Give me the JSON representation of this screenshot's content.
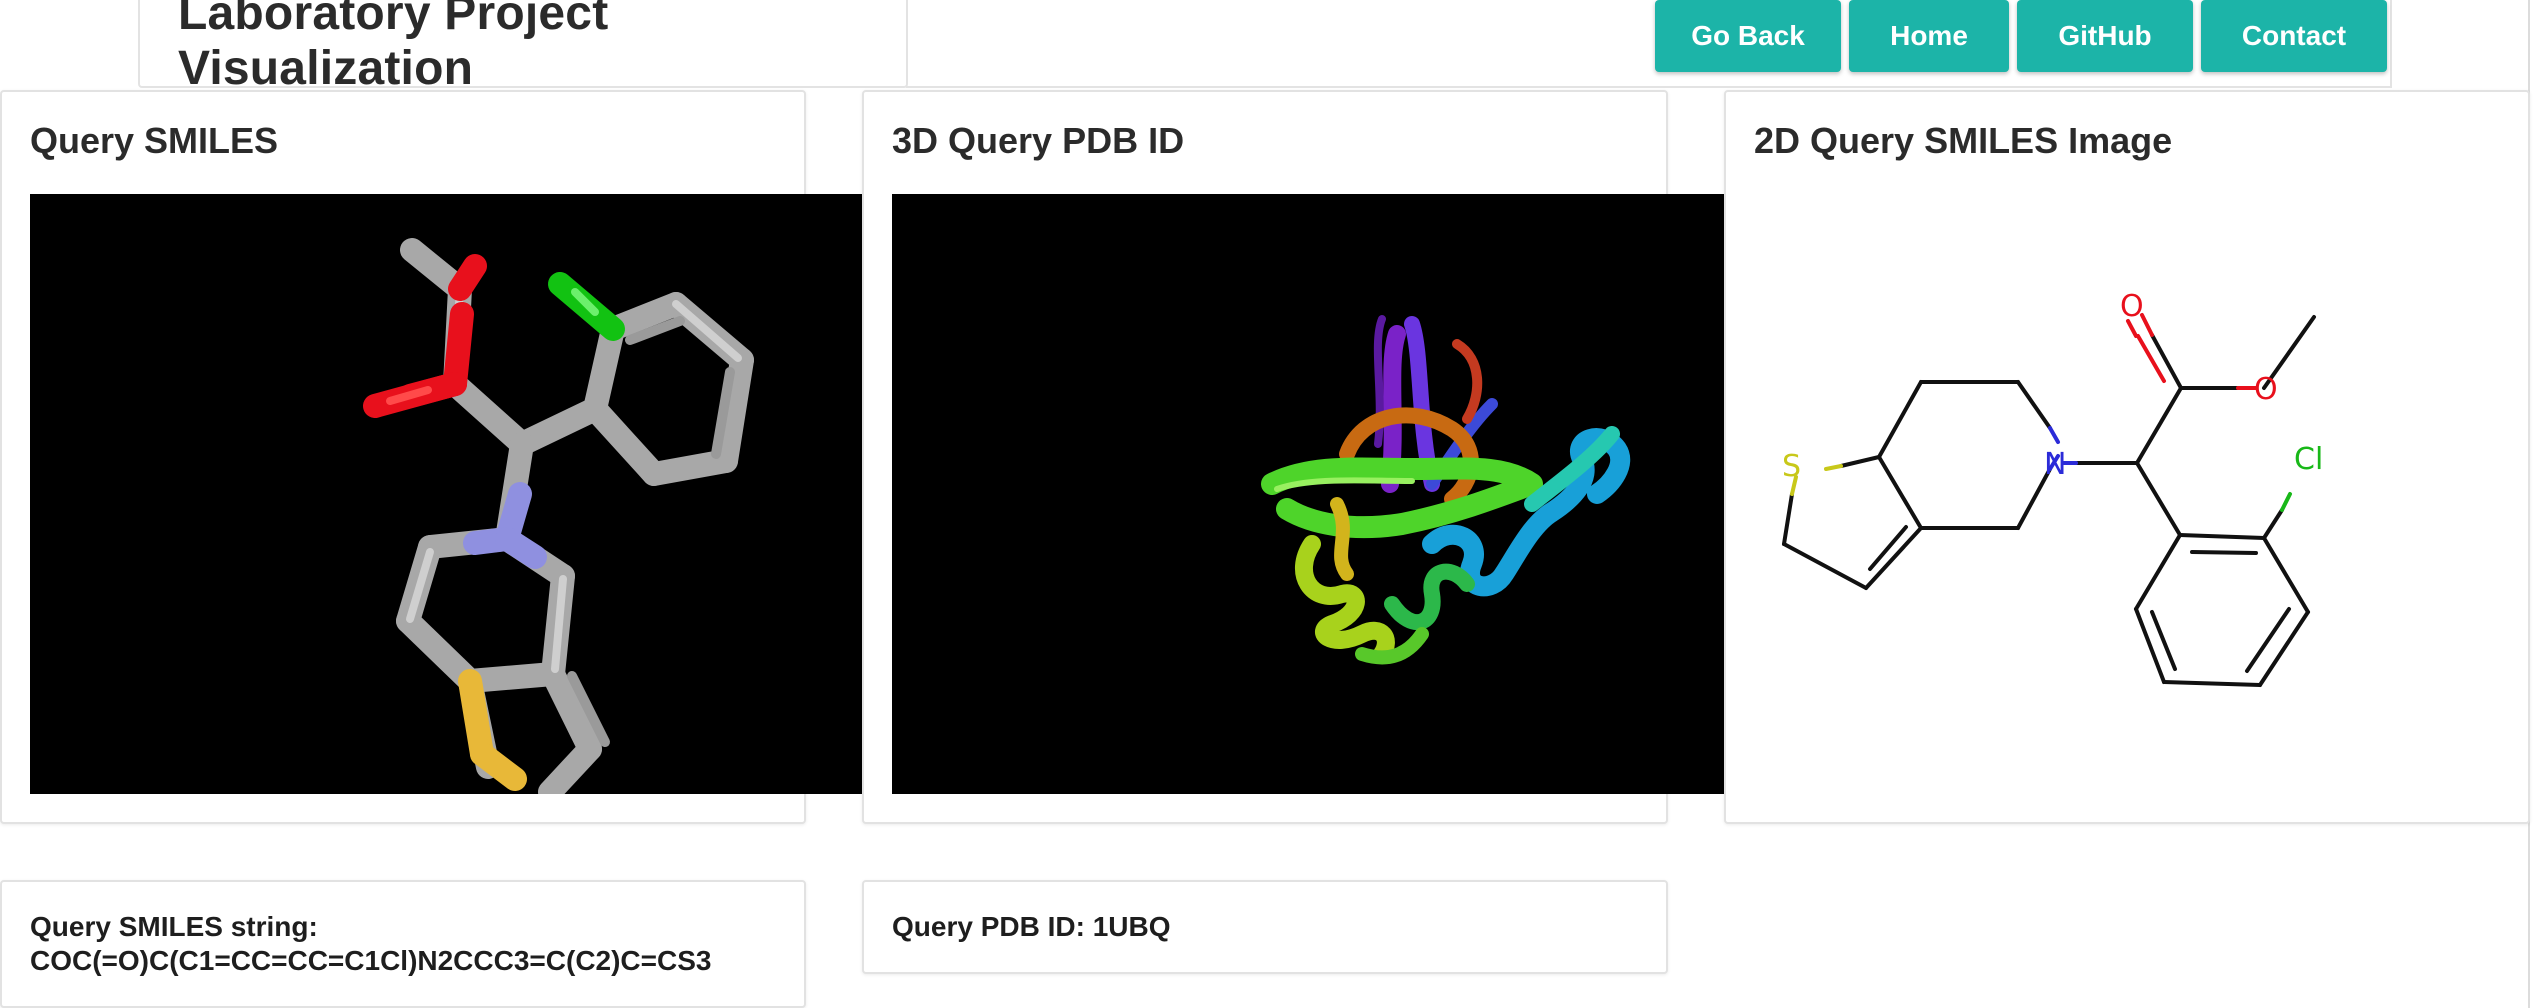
{
  "header": {
    "title": "Laboratory Project Visualization",
    "nav": [
      {
        "label": "Go Back"
      },
      {
        "label": "Home"
      },
      {
        "label": "GitHub"
      },
      {
        "label": "Contact"
      }
    ]
  },
  "panels": {
    "query_smiles": {
      "title": "Query SMILES",
      "atom_labels": [
        "O",
        "O",
        "Cl",
        "N",
        "S"
      ]
    },
    "pdb_3d": {
      "title": "3D Query PDB ID"
    },
    "smiles_2d": {
      "title": "2D Query SMILES Image",
      "atom_labels": {
        "o1": "O",
        "o2": "O",
        "n": "N",
        "s": "S",
        "cl": "Cl"
      }
    }
  },
  "info": {
    "smiles_label": "Query SMILES string:",
    "smiles_value": "COC(=O)C(C1=CC=CC=C1Cl)N2CCC3=C(C2)C=CS3",
    "pdb_text": "Query PDB ID: 1UBQ"
  },
  "colors": {
    "accent": "#1cb4a8",
    "viewer_bg": "#000000",
    "carbon": "#b3b3b3",
    "oxygen": "#e8101c",
    "nitrogen": "#8f90e0",
    "sulfur": "#e8b838",
    "chlorine": "#1fd11f"
  }
}
